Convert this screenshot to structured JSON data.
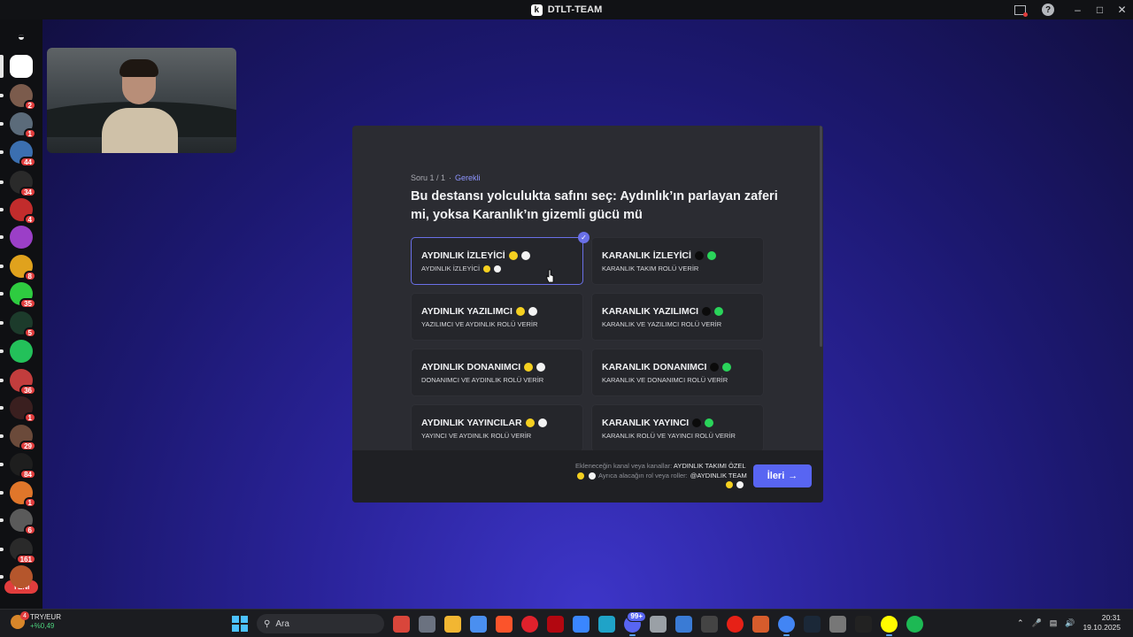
{
  "window": {
    "title": "DTLT-TEAM"
  },
  "sidebar": {
    "servers": [
      {
        "name": "discord-home-icon",
        "badge": "",
        "color": "#2b2d31"
      },
      {
        "name": "dtlt-team-server",
        "badge": "",
        "color": "#ffffff"
      },
      {
        "name": "server-2",
        "badge": "2",
        "color": "#7b5b4c"
      },
      {
        "name": "server-3",
        "badge": "1",
        "color": "#5b6b7a"
      },
      {
        "name": "server-4",
        "badge": "44",
        "color": "#3b6fb0"
      },
      {
        "name": "server-5",
        "badge": "34",
        "color": "#2a2a2a"
      },
      {
        "name": "server-6",
        "badge": "4",
        "color": "#c22c2c"
      },
      {
        "name": "server-7",
        "badge": "",
        "color": "#9b3fc7"
      },
      {
        "name": "server-8",
        "badge": "8",
        "color": "#e0a21d"
      },
      {
        "name": "server-9",
        "badge": "35",
        "color": "#2ecc40"
      },
      {
        "name": "server-10",
        "badge": "5",
        "color": "#1c3b2b"
      },
      {
        "name": "server-11",
        "badge": "",
        "color": "#23c15a"
      },
      {
        "name": "server-12",
        "badge": "36",
        "color": "#c23d3d"
      },
      {
        "name": "server-13",
        "badge": "1",
        "color": "#3a1f1f"
      },
      {
        "name": "server-14",
        "badge": "29",
        "color": "#6b4a3a"
      },
      {
        "name": "server-15",
        "badge": "84",
        "color": "#1e1e1e"
      },
      {
        "name": "server-16",
        "badge": "1",
        "color": "#e0762a"
      },
      {
        "name": "server-17",
        "badge": "6",
        "color": "#5a5a5a"
      },
      {
        "name": "server-18",
        "badge": "161",
        "color": "#2a2a2a"
      },
      {
        "name": "server-19",
        "badge": "",
        "color": "#b5562c"
      }
    ],
    "new_label": "YENİ"
  },
  "question": {
    "counter": "Soru 1 / 1",
    "required": "Gerekli",
    "title": "Bu destansı yolculukta safını seç: Aydınlık’ın parlayan zaferi mi, yoksa Karanlık’ın gizemli gücü mü"
  },
  "options": [
    {
      "title": "AYDINLIK İZLEYİCİ",
      "subtitle": "AYDINLIK İZLEYİCİ",
      "dots": [
        "y",
        "w"
      ],
      "sub_dots": [
        "y",
        "w"
      ],
      "selected": true
    },
    {
      "title": "KARANLIK İZLEYİCİ",
      "subtitle": "KARANLIK TAKIM ROLÜ VERİR",
      "dots": [
        "k",
        "g"
      ],
      "sub_dots": [],
      "selected": false
    },
    {
      "title": "AYDINLIK YAZILIMCI",
      "subtitle": "YAZILIMCI VE AYDINLIK ROLÜ VERİR",
      "dots": [
        "y",
        "w"
      ],
      "sub_dots": [],
      "selected": false
    },
    {
      "title": "KARANLIK YAZILIMCI",
      "subtitle": "KARANLIK VE YAZILIMCI ROLÜ VERİR",
      "dots": [
        "k",
        "g"
      ],
      "sub_dots": [],
      "selected": false
    },
    {
      "title": "AYDINLIK DONANIMCI",
      "subtitle": "DONANIMCI VE AYDINLIK ROLÜ VERİR",
      "dots": [
        "y",
        "w"
      ],
      "sub_dots": [],
      "selected": false
    },
    {
      "title": "KARANLIK DONANIMCI",
      "subtitle": "KARANLIK VE DONANIMCI ROLÜ VERİR",
      "dots": [
        "k",
        "g"
      ],
      "sub_dots": [],
      "selected": false
    },
    {
      "title": "AYDINLIK YAYINCILAR",
      "subtitle": "YAYINCI VE AYDINLIK ROLÜ VERİR",
      "dots": [
        "y",
        "w"
      ],
      "sub_dots": [],
      "selected": false
    },
    {
      "title": "KARANLIK YAYINCI",
      "subtitle": "KARANLIK ROLÜ VE YAYINCI ROLÜ VERİR",
      "dots": [
        "k",
        "g"
      ],
      "sub_dots": [],
      "selected": false
    }
  ],
  "footer": {
    "channels_prefix": "Ekleneceğin kanal veya kanallar:",
    "channels_value": "AYDINLIK TAKIMI ÖZEL",
    "roles_prefix": "Ayrıca alacağın rol veya roller:",
    "roles_value": "@AYDINLIK TEAM",
    "next_label": "İleri"
  },
  "taskbar": {
    "stock_name": "TRY/EUR",
    "stock_change": "+%0,49",
    "search_placeholder": "Ara",
    "time": "20:31",
    "date": "19.10.2025",
    "chrome_badge": "99+"
  },
  "colors": {
    "accent": "#5865f2",
    "light_yellow": "#f5d020",
    "light_white": "#f3f3f3",
    "dark_black": "#0b0b0b",
    "dark_green": "#2ad45a"
  }
}
